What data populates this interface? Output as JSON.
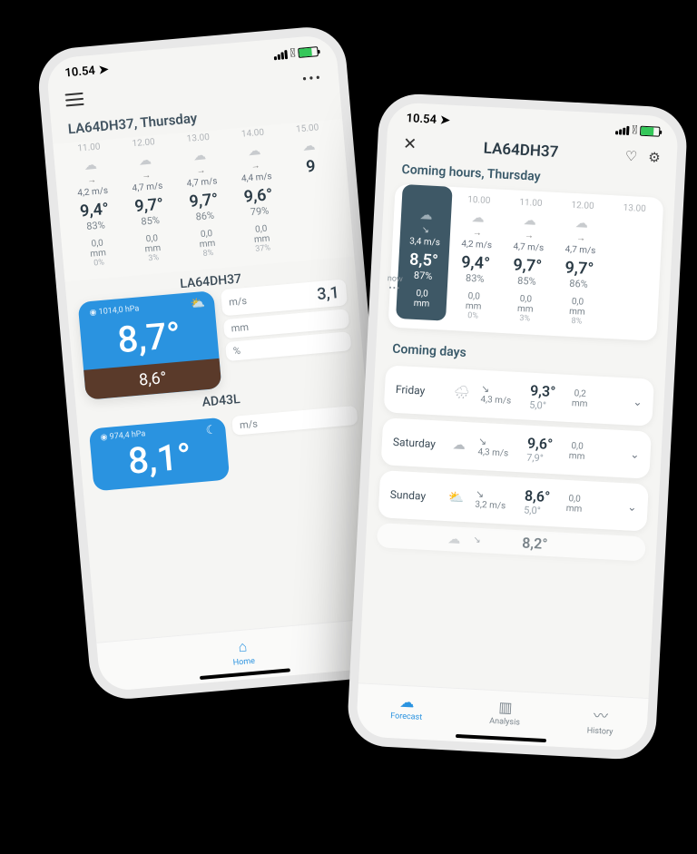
{
  "status": {
    "time": "10.54"
  },
  "phone1": {
    "header": "LA64DH37, Thursday",
    "hours": [
      {
        "time": "11.00",
        "wind": "4,2 m/s",
        "temp": "9,4°",
        "hum": "83%",
        "precip": "0,0",
        "precip_unit": "mm",
        "precip_pct": "0%"
      },
      {
        "time": "12.00",
        "wind": "4,7 m/s",
        "temp": "9,7°",
        "hum": "85%",
        "precip": "0,0",
        "precip_unit": "mm",
        "precip_pct": "3%"
      },
      {
        "time": "13.00",
        "wind": "4,7 m/s",
        "temp": "9,7°",
        "hum": "86%",
        "precip": "0,0",
        "precip_unit": "mm",
        "precip_pct": "8%"
      },
      {
        "time": "14.00",
        "wind": "4,4 m/s",
        "temp": "9,6°",
        "hum": "79%",
        "precip": "0,0",
        "precip_unit": "mm",
        "precip_pct": "37%"
      },
      {
        "time": "15.00",
        "wind": "",
        "temp": "9",
        "hum": "",
        "precip": "",
        "precip_unit": "",
        "precip_pct": ""
      }
    ],
    "station1": {
      "label": "LA64DH37",
      "pressure": "1014,0 hPa",
      "temp": "8,7°",
      "sub_temp": "8,6°",
      "meter1_val": "3,1",
      "meter1_unit": "m/s",
      "meter2_unit": "mm",
      "meter3_unit": "%"
    },
    "station2": {
      "label": "AD43L",
      "pressure": "974,4 hPa",
      "temp": "8,1°",
      "meter_unit": "m/s"
    },
    "nav": {
      "home": "Home"
    }
  },
  "phone2": {
    "title": "LA64DH37",
    "subtitle": "Coming hours, Thursday",
    "now_label": "now",
    "hours": [
      {
        "time": "",
        "wind": "3,4 m/s",
        "temp": "8,5°",
        "hum": "87%",
        "precip": "0,0",
        "precip_unit": "mm",
        "precip_pct": ""
      },
      {
        "time": "10.00",
        "wind": "4,2 m/s",
        "temp": "9,4°",
        "hum": "83%",
        "precip": "0,0",
        "precip_unit": "mm",
        "precip_pct": "0%"
      },
      {
        "time": "11.00",
        "wind": "4,7 m/s",
        "temp": "9,7°",
        "hum": "85%",
        "precip": "0,0",
        "precip_unit": "mm",
        "precip_pct": "3%"
      },
      {
        "time": "12.00",
        "wind": "4,7 m/s",
        "temp": "9,7°",
        "hum": "86%",
        "precip": "0,0",
        "precip_unit": "mm",
        "precip_pct": "8%"
      },
      {
        "time": "13.00",
        "wind": "",
        "temp": "",
        "hum": "",
        "precip": "",
        "precip_unit": "",
        "precip_pct": ""
      }
    ],
    "days_title": "Coming days",
    "days": [
      {
        "label": "Friday",
        "wind": "4,3 m/s",
        "hi": "9,3°",
        "lo": "5,0°",
        "precip": "0,2",
        "precip_unit": "mm"
      },
      {
        "label": "Saturday",
        "wind": "4,3 m/s",
        "hi": "9,6°",
        "lo": "7,9°",
        "precip": "0,0",
        "precip_unit": "mm"
      },
      {
        "label": "Sunday",
        "wind": "3,2 m/s",
        "hi": "8,6°",
        "lo": "5,0°",
        "precip": "0,0",
        "precip_unit": "mm"
      }
    ],
    "nav": {
      "forecast": "Forecast",
      "analysis": "Analysis",
      "history": "History"
    },
    "peek_temp": "8,2°"
  }
}
